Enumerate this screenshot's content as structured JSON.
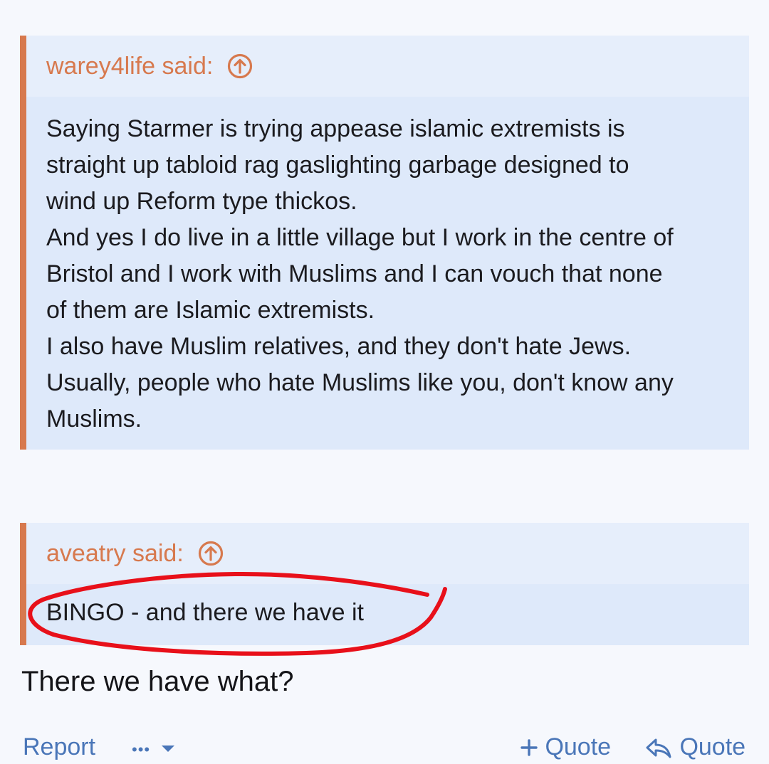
{
  "quotes": [
    {
      "author": "warey4life said:",
      "lines": [
        "Saying Starmer is trying appease islamic extremists is",
        "straight up tabloid rag gaslighting garbage designed to",
        "wind up Reform type thickos.",
        "And yes I do live in a little village but I work in the centre of",
        "Bristol and I work with Muslims and I can vouch that none",
        "of them are Islamic extremists.",
        "I also have Muslim relatives, and they don't hate Jews.",
        "Usually, people who hate Muslims like you, don't know any",
        "Muslims."
      ]
    },
    {
      "author": "aveatry said:",
      "lines": [
        "BINGO - and there we have it"
      ]
    }
  ],
  "reply": "There we have what?",
  "actions": {
    "report": "Report",
    "more": "•••",
    "multiquote": "Quote",
    "quote": "Quote"
  },
  "colors": {
    "accent": "#d7794e",
    "link": "#4a76b8",
    "annotation": "#e8101a"
  },
  "icons": [
    "jump-to-quote-icon",
    "chevron-down-icon",
    "plus-icon",
    "reply-icon"
  ]
}
